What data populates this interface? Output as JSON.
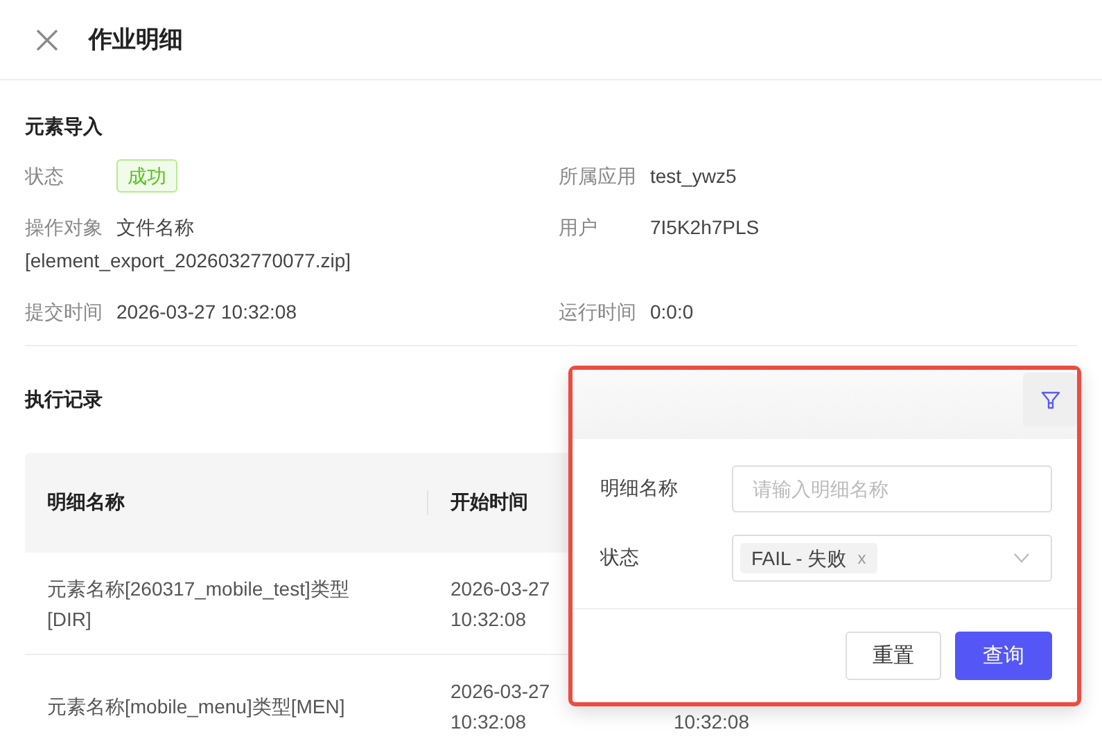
{
  "header": {
    "title": "作业明细"
  },
  "job": {
    "title": "元素导入",
    "rows": [
      [
        {
          "label": "状态",
          "kind": "tag",
          "value": "成功"
        },
        {
          "label": "所属应用",
          "kind": "text",
          "value": "test_ywz5"
        }
      ],
      [
        {
          "label": "操作对象",
          "kind": "text",
          "value": "文件名称 [element_export_2026032770077.zip]"
        },
        {
          "label": "用户",
          "kind": "text",
          "value": "7I5K2h7PLS"
        }
      ],
      [
        {
          "label": "提交时间",
          "kind": "text",
          "value": "2026-03-27 10:32:08"
        },
        {
          "label": "运行时间",
          "kind": "text",
          "value": "0:0:0"
        }
      ]
    ]
  },
  "records": {
    "title": "执行记录",
    "columns": [
      "明细名称",
      "开始时间"
    ],
    "rows": [
      {
        "cells": [
          "元素名称[260317_mobile_test]类型[DIR]",
          "2026-03-27 10:32:08"
        ]
      },
      {
        "cells": [
          "元素名称[mobile_menu]类型[MEN]",
          "2026-03-27 10:32:08"
        ],
        "column_3": "10:32:08"
      }
    ]
  },
  "filter_popover": {
    "fields": [
      {
        "label": "明细名称",
        "kind": "input",
        "placeholder": "请输入明细名称"
      },
      {
        "label": "状态",
        "kind": "select",
        "chips": [
          "FAIL - 失败"
        ],
        "chip_remove": "x"
      }
    ],
    "buttons": [
      {
        "label": "重置",
        "primary": false
      },
      {
        "label": "查询",
        "primary": true
      }
    ]
  }
}
